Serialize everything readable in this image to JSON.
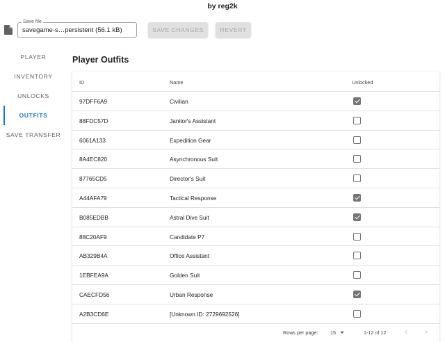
{
  "header": {
    "title": "by reg2k"
  },
  "file": {
    "label": "Save file",
    "value": "savegame-s…persistent (56.1 kB)",
    "icon": "file-icon"
  },
  "toolbar": {
    "save_label": "SAVE CHANGES",
    "revert_label": "REVERT"
  },
  "nav": {
    "items": [
      {
        "label": "PLAYER"
      },
      {
        "label": "INVENTORY"
      },
      {
        "label": "UNLOCKS"
      },
      {
        "label": "OUTFITS",
        "active": true
      },
      {
        "label": "SAVE TRANSFER"
      }
    ]
  },
  "main": {
    "title": "Player Outfits",
    "columns": {
      "id": "ID",
      "name": "Name",
      "unlocked": "Unlocked"
    },
    "rows": [
      {
        "id": "97DFF6A9",
        "name": "Civilian",
        "unlocked": true
      },
      {
        "id": "88FDC57D",
        "name": "Janitor's Assistant",
        "unlocked": false
      },
      {
        "id": "6061A133",
        "name": "Expedition Gear",
        "unlocked": false
      },
      {
        "id": "8A4EC820",
        "name": "Asynchronous Suit",
        "unlocked": false
      },
      {
        "id": "87765CD5",
        "name": "Director's Suit",
        "unlocked": false
      },
      {
        "id": "A44AFA79",
        "name": "Tactical Response",
        "unlocked": true
      },
      {
        "id": "B085EDBB",
        "name": "Astral Dive Suit",
        "unlocked": true
      },
      {
        "id": "88C20AF9",
        "name": "Candidate P7",
        "unlocked": false
      },
      {
        "id": "AB329B4A",
        "name": "Office Assistant",
        "unlocked": false
      },
      {
        "id": "1EBFEA9A",
        "name": "Golden Suit",
        "unlocked": false
      },
      {
        "id": "CAECFD56",
        "name": "Urban Response",
        "unlocked": true
      },
      {
        "id": "A2B3CD6E",
        "name": "[Unknown ID: 2729692526]",
        "unlocked": false
      }
    ]
  },
  "pagination": {
    "rows_per_page_label": "Rows per page:",
    "rows_per_page_value": "15",
    "range": "1-12 of 12",
    "prev_icon": "chevron-left-icon",
    "next_icon": "chevron-right-icon"
  },
  "colors": {
    "accent": "#1976d2",
    "disabled_button_bg": "#e0e0e0",
    "checkbox_checked": "#757575"
  }
}
